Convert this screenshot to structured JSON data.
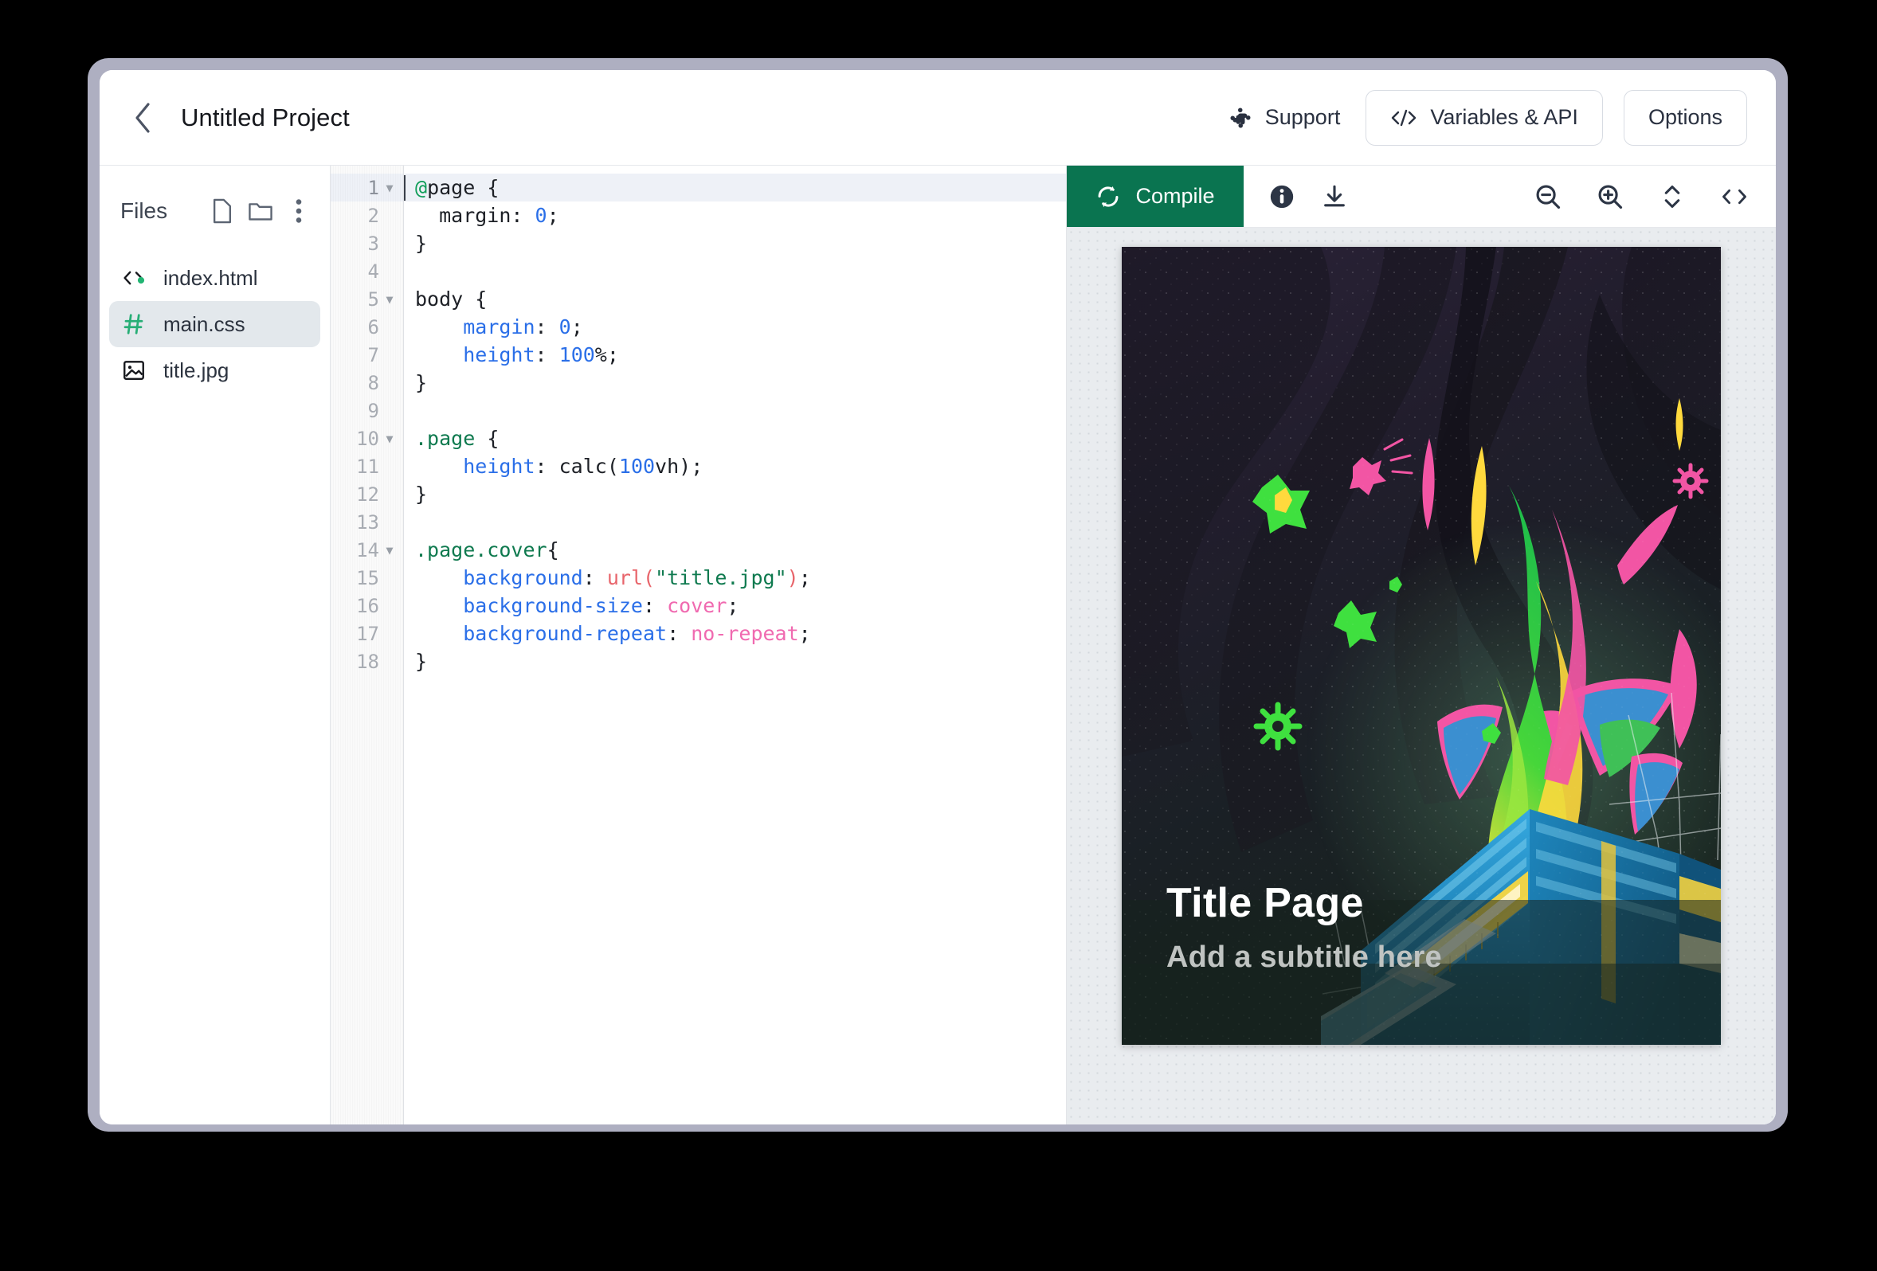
{
  "header": {
    "back_icon": "chevron-left-icon",
    "title": "Untitled Project",
    "support_label": "Support",
    "support_icon": "slack-icon",
    "variables_label": "Variables & API",
    "variables_icon": "code-brackets-icon",
    "options_label": "Options"
  },
  "sidebar": {
    "label": "Files",
    "actions": [
      {
        "name": "new-file-button",
        "icon": "file-icon"
      },
      {
        "name": "new-folder-button",
        "icon": "folder-icon"
      },
      {
        "name": "more-options-button",
        "icon": "kebab-menu-icon"
      }
    ],
    "files": [
      {
        "name": "index.html",
        "icon": "html-file-icon",
        "selected": false
      },
      {
        "name": "main.css",
        "icon": "css-hash-icon",
        "selected": true
      },
      {
        "name": "title.jpg",
        "icon": "image-file-icon",
        "selected": false
      }
    ]
  },
  "editor": {
    "active_line": 1,
    "lines": [
      {
        "n": 1,
        "fold": true,
        "info": false,
        "tokens": [
          {
            "t": "@",
            "c": "t-at"
          },
          {
            "t": "page {",
            "c": "t-punc"
          }
        ]
      },
      {
        "n": 2,
        "fold": false,
        "info": false,
        "tokens": [
          {
            "t": "  margin",
            "c": "t-punc"
          },
          {
            "t": ": ",
            "c": "t-punc"
          },
          {
            "t": "0",
            "c": "t-num"
          },
          {
            "t": ";",
            "c": "t-punc"
          }
        ]
      },
      {
        "n": 3,
        "fold": false,
        "info": false,
        "tokens": [
          {
            "t": "}",
            "c": "t-punc"
          }
        ]
      },
      {
        "n": 4,
        "fold": false,
        "info": false,
        "tokens": []
      },
      {
        "n": 5,
        "fold": true,
        "info": false,
        "tokens": [
          {
            "t": "body {",
            "c": "t-punc"
          }
        ]
      },
      {
        "n": 6,
        "fold": false,
        "info": false,
        "tokens": [
          {
            "t": "    ",
            "c": "t-punc"
          },
          {
            "t": "margin",
            "c": "t-prop"
          },
          {
            "t": ": ",
            "c": "t-punc"
          },
          {
            "t": "0",
            "c": "t-num"
          },
          {
            "t": ";",
            "c": "t-punc"
          }
        ]
      },
      {
        "n": 7,
        "fold": false,
        "info": false,
        "tokens": [
          {
            "t": "    ",
            "c": "t-punc"
          },
          {
            "t": "height",
            "c": "t-prop"
          },
          {
            "t": ": ",
            "c": "t-punc"
          },
          {
            "t": "100",
            "c": "t-num"
          },
          {
            "t": "%;",
            "c": "t-punc"
          }
        ]
      },
      {
        "n": 8,
        "fold": false,
        "info": false,
        "tokens": [
          {
            "t": "}",
            "c": "t-punc"
          }
        ]
      },
      {
        "n": 9,
        "fold": false,
        "info": false,
        "tokens": []
      },
      {
        "n": 10,
        "fold": true,
        "info": false,
        "tokens": [
          {
            "t": ".page",
            "c": "t-sel"
          },
          {
            "t": " {",
            "c": "t-punc"
          }
        ]
      },
      {
        "n": 11,
        "fold": false,
        "info": false,
        "tokens": [
          {
            "t": "    ",
            "c": "t-punc"
          },
          {
            "t": "height",
            "c": "t-prop"
          },
          {
            "t": ": calc(",
            "c": "t-punc"
          },
          {
            "t": "100",
            "c": "t-num"
          },
          {
            "t": "vh);",
            "c": "t-punc"
          }
        ]
      },
      {
        "n": 12,
        "fold": false,
        "info": false,
        "tokens": [
          {
            "t": "}",
            "c": "t-punc"
          }
        ]
      },
      {
        "n": 13,
        "fold": false,
        "info": false,
        "tokens": []
      },
      {
        "n": 14,
        "fold": true,
        "info": true,
        "tokens": [
          {
            "t": ".page.cover",
            "c": "t-sel"
          },
          {
            "t": "{",
            "c": "t-punc"
          }
        ]
      },
      {
        "n": 15,
        "fold": false,
        "info": false,
        "tokens": [
          {
            "t": "    ",
            "c": "t-punc"
          },
          {
            "t": "background",
            "c": "t-prop"
          },
          {
            "t": ": ",
            "c": "t-punc"
          },
          {
            "t": "url",
            "c": "t-func"
          },
          {
            "t": "(",
            "c": "t-func"
          },
          {
            "t": "\"title.jpg\"",
            "c": "t-str"
          },
          {
            "t": ")",
            "c": "t-func"
          },
          {
            "t": ";",
            "c": "t-punc"
          }
        ]
      },
      {
        "n": 16,
        "fold": false,
        "info": false,
        "tokens": [
          {
            "t": "    ",
            "c": "t-punc"
          },
          {
            "t": "background-size",
            "c": "t-prop"
          },
          {
            "t": ": ",
            "c": "t-punc"
          },
          {
            "t": "cover",
            "c": "t-kw"
          },
          {
            "t": ";",
            "c": "t-punc"
          }
        ]
      },
      {
        "n": 17,
        "fold": false,
        "info": false,
        "tokens": [
          {
            "t": "    ",
            "c": "t-punc"
          },
          {
            "t": "background-repeat",
            "c": "t-prop"
          },
          {
            "t": ": ",
            "c": "t-punc"
          },
          {
            "t": "no-repeat",
            "c": "t-kw"
          },
          {
            "t": ";",
            "c": "t-punc"
          }
        ]
      },
      {
        "n": 18,
        "fold": false,
        "info": false,
        "tokens": [
          {
            "t": "}",
            "c": "t-punc"
          }
        ]
      }
    ]
  },
  "preview": {
    "compile_label": "Compile",
    "compile_icon": "refresh-icon",
    "compile_color": "#0a7450",
    "toolbar_icons": [
      {
        "name": "info-icon"
      },
      {
        "name": "download-icon"
      },
      {
        "name": "zoom-out-icon"
      },
      {
        "name": "zoom-in-icon"
      },
      {
        "name": "fit-height-icon"
      },
      {
        "name": "view-source-icon"
      }
    ],
    "page": {
      "title": "Title Page",
      "subtitle": "Add a subtitle here",
      "title_color": "#ffffff",
      "subtitle_color": "#c0c4c2",
      "background_image": "title.jpg"
    }
  }
}
